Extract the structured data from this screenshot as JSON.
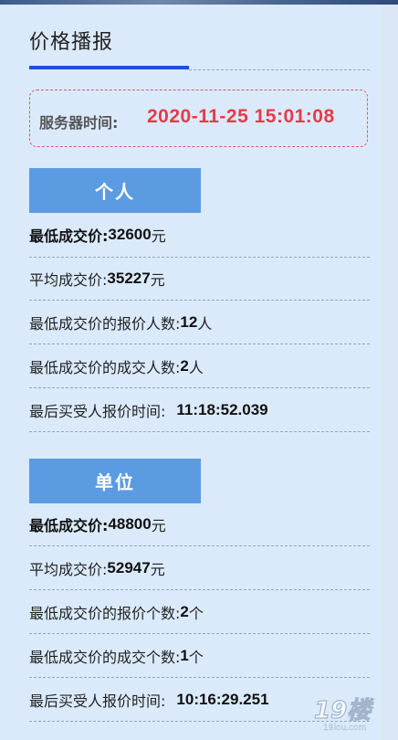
{
  "header": {
    "title": "价格播报"
  },
  "server": {
    "label": "服务器时间:",
    "time": "2020-11-25 15:01:08"
  },
  "sections": [
    {
      "heading": "个人",
      "rows": [
        {
          "label": "最低成交价:",
          "value": "32600",
          "unit": "元"
        },
        {
          "label": "平均成交价:",
          "value": "35227",
          "unit": "元"
        },
        {
          "label": "最低成交价的报价人数:",
          "value": "12",
          "unit": "人"
        },
        {
          "label": "最低成交价的成交人数:",
          "value": "2",
          "unit": "人"
        },
        {
          "label": "最后买受人报价时间:",
          "value": "11:18:52.039",
          "unit": ""
        }
      ]
    },
    {
      "heading": "单位",
      "rows": [
        {
          "label": "最低成交价:",
          "value": "48800",
          "unit": "元"
        },
        {
          "label": "平均成交价:",
          "value": "52947",
          "unit": "元"
        },
        {
          "label": "最低成交价的报价个数:",
          "value": "2",
          "unit": "个"
        },
        {
          "label": "最低成交价的成交个数:",
          "value": "1",
          "unit": "个"
        },
        {
          "label": "最后买受人报价时间:",
          "value": "10:16:29.251",
          "unit": ""
        }
      ]
    }
  ],
  "watermark": {
    "logo": "19楼",
    "site": "19lou.com"
  },
  "colors": {
    "accent": "#1c4fe8",
    "header_bg": "#5b9be1",
    "time_red": "#e53b47",
    "page_bg": "#dbeafb"
  }
}
